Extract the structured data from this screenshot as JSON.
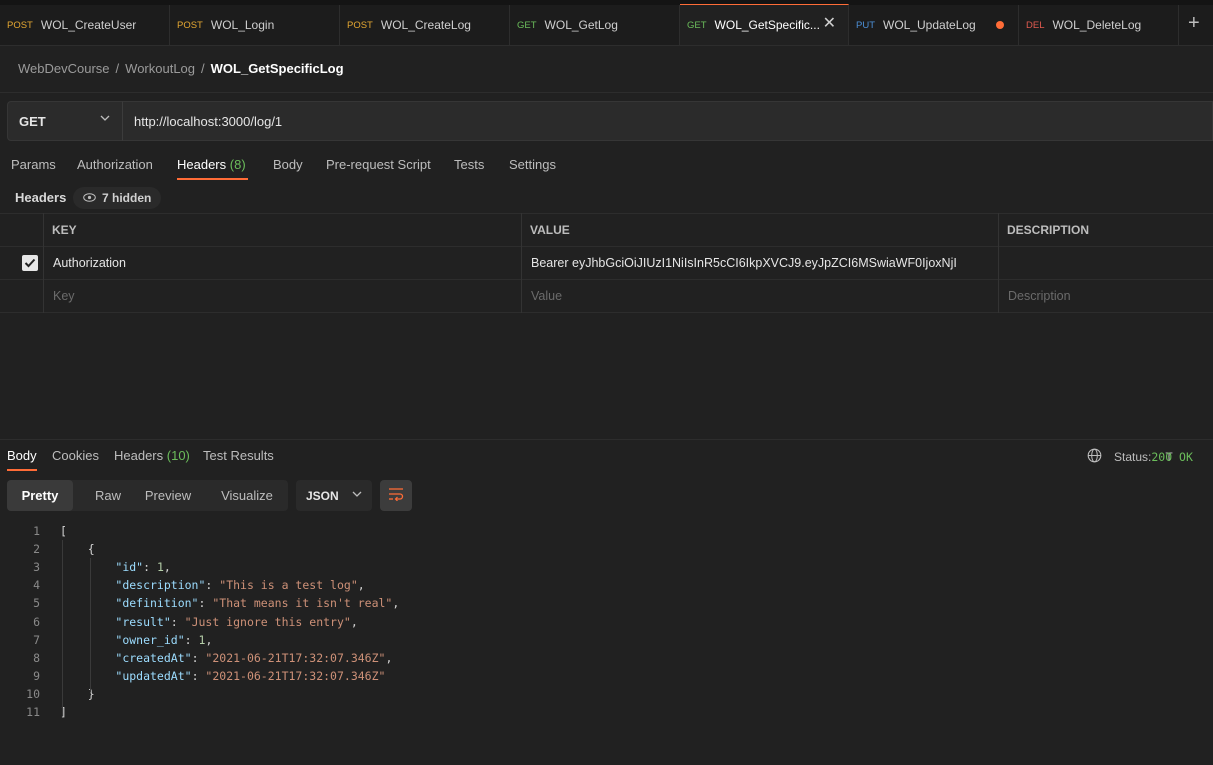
{
  "tabs": [
    {
      "method": "POST",
      "name": "WOL_CreateUser"
    },
    {
      "method": "POST",
      "name": "WOL_Login"
    },
    {
      "method": "POST",
      "name": "WOL_CreateLog"
    },
    {
      "method": "GET",
      "name": "WOL_GetLog"
    },
    {
      "method": "GET",
      "name": "WOL_GetSpecific...",
      "active": true
    },
    {
      "method": "PUT",
      "name": "WOL_UpdateLog",
      "unsaved": true
    },
    {
      "method": "DEL",
      "name": "WOL_DeleteLog"
    }
  ],
  "icons": {
    "close": "close-icon",
    "new_tab": "plus-icon",
    "eye": "eye-icon",
    "globe": "globe-icon",
    "wrap": "wrap-lines-icon",
    "check": "check-icon",
    "chevron": "chevron-down-icon"
  },
  "breadcrumb": {
    "items": [
      "WebDevCourse",
      "WorkoutLog"
    ],
    "sep": "/",
    "current": "WOL_GetSpecificLog"
  },
  "request": {
    "method": "GET",
    "url": "http://localhost:3000/log/1"
  },
  "request_tabs": {
    "params": "Params",
    "authorization": "Authorization",
    "headers": "Headers",
    "headers_count": "(8)",
    "body": "Body",
    "prerequest": "Pre-request Script",
    "tests": "Tests",
    "settings": "Settings"
  },
  "headers_section": {
    "label": "Headers",
    "hidden": "7 hidden"
  },
  "table": {
    "columns": {
      "key": "KEY",
      "value": "VALUE",
      "description": "DESCRIPTION"
    },
    "row": {
      "checked": true,
      "key": "Authorization",
      "value": "Bearer eyJhbGciOiJIUzI1NiIsInR5cCI6IkpXVCJ9.eyJpZCI6MSwiaWF0IjoxNjI",
      "description": ""
    },
    "placeholders": {
      "key": "Key",
      "value": "Value",
      "description": "Description"
    }
  },
  "response_tabs": {
    "body": "Body",
    "cookies": "Cookies",
    "headers": "Headers",
    "headers_count": "(10)",
    "test_results": "Test Results"
  },
  "status": {
    "label": "Status:",
    "code": "200 OK",
    "trailing": "T"
  },
  "view_modes": [
    "Pretty",
    "Raw",
    "Preview",
    "Visualize"
  ],
  "format": "JSON",
  "code_lines": [
    {
      "n": "1",
      "tokens": [
        [
          "p",
          "["
        ]
      ]
    },
    {
      "n": "2",
      "tokens": [
        [
          "p",
          "    {"
        ]
      ]
    },
    {
      "n": "3",
      "tokens": [
        [
          "p",
          "        "
        ],
        [
          "k",
          "\"id\""
        ],
        [
          "p",
          ": "
        ],
        [
          "n",
          "1"
        ],
        [
          "p",
          ","
        ]
      ]
    },
    {
      "n": "4",
      "tokens": [
        [
          "p",
          "        "
        ],
        [
          "k",
          "\"description\""
        ],
        [
          "p",
          ": "
        ],
        [
          "s",
          "\"This is a test log\""
        ],
        [
          "p",
          ","
        ]
      ]
    },
    {
      "n": "5",
      "tokens": [
        [
          "p",
          "        "
        ],
        [
          "k",
          "\"definition\""
        ],
        [
          "p",
          ": "
        ],
        [
          "s",
          "\"That means it isn't real\""
        ],
        [
          "p",
          ","
        ]
      ]
    },
    {
      "n": "6",
      "tokens": [
        [
          "p",
          "        "
        ],
        [
          "k",
          "\"result\""
        ],
        [
          "p",
          ": "
        ],
        [
          "s",
          "\"Just ignore this entry\""
        ],
        [
          "p",
          ","
        ]
      ]
    },
    {
      "n": "7",
      "tokens": [
        [
          "p",
          "        "
        ],
        [
          "k",
          "\"owner_id\""
        ],
        [
          "p",
          ": "
        ],
        [
          "n",
          "1"
        ],
        [
          "p",
          ","
        ]
      ]
    },
    {
      "n": "8",
      "tokens": [
        [
          "p",
          "        "
        ],
        [
          "k",
          "\"createdAt\""
        ],
        [
          "p",
          ": "
        ],
        [
          "s",
          "\"2021-06-21T17:32:07.346Z\""
        ],
        [
          "p",
          ","
        ]
      ]
    },
    {
      "n": "9",
      "tokens": [
        [
          "p",
          "        "
        ],
        [
          "k",
          "\"updatedAt\""
        ],
        [
          "p",
          ": "
        ],
        [
          "s",
          "\"2021-06-21T17:32:07.346Z\""
        ]
      ]
    },
    {
      "n": "10",
      "tokens": [
        [
          "p",
          "    }"
        ]
      ]
    },
    {
      "n": "11",
      "tokens": [
        [
          "p",
          "]"
        ]
      ]
    }
  ],
  "colors": {
    "accent": "#ff6c37",
    "success": "#6bbd5b",
    "post": "#e5a832",
    "get": "#6bbd5b",
    "put": "#4c8fd6",
    "del": "#e05a4f"
  }
}
